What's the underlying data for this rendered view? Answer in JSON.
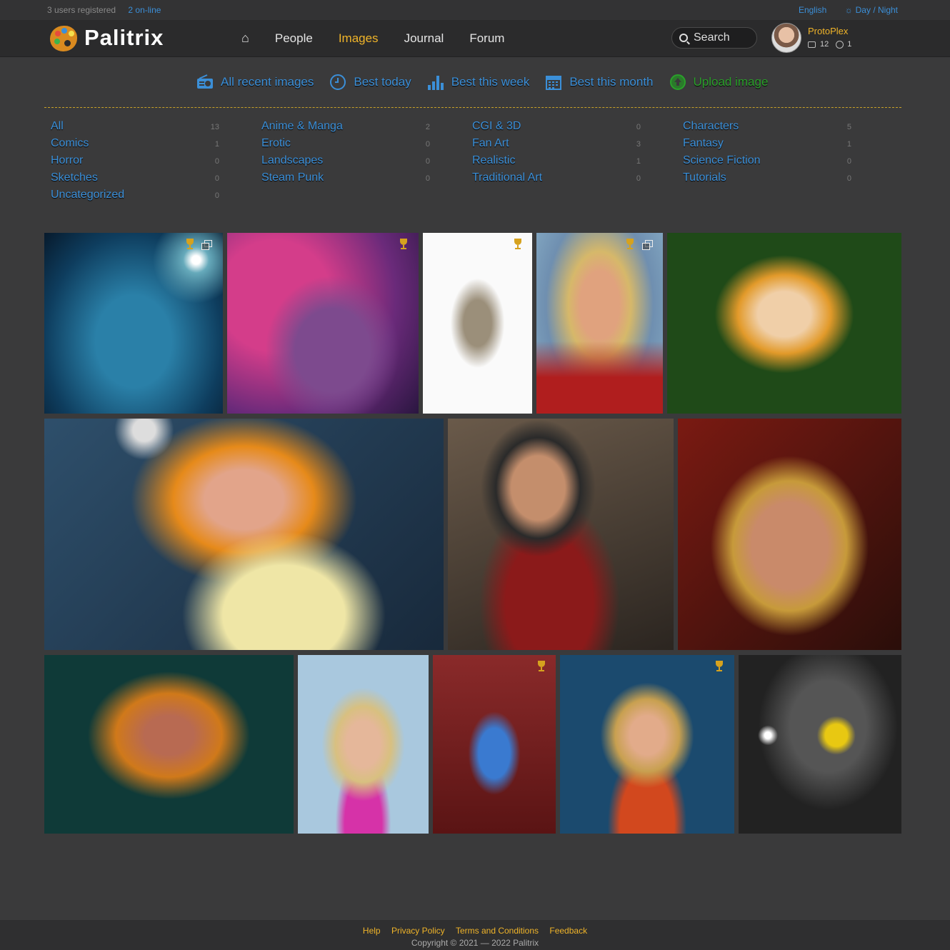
{
  "topbar": {
    "users_registered": "3 users registered",
    "online": "2 on-line",
    "language": "English",
    "day_night": "Day / Night"
  },
  "header": {
    "logo_text": "Palitrix",
    "nav": [
      "People",
      "Images",
      "Journal",
      "Forum"
    ],
    "active_nav": "Images",
    "search_placeholder": "Search",
    "user": {
      "name": "ProtoPlex",
      "images": "12",
      "other": "1"
    }
  },
  "subnav": {
    "all_recent": "All recent images",
    "best_today": "Best today",
    "best_week": "Best this week",
    "best_month": "Best this month",
    "upload": "Upload image"
  },
  "categories": [
    {
      "name": "All",
      "count": "13"
    },
    {
      "name": "Anime & Manga",
      "count": "2"
    },
    {
      "name": "CGI & 3D",
      "count": "0"
    },
    {
      "name": "Characters",
      "count": "5"
    },
    {
      "name": "Comics",
      "count": "1"
    },
    {
      "name": "Erotic",
      "count": "0"
    },
    {
      "name": "Fan Art",
      "count": "3"
    },
    {
      "name": "Fantasy",
      "count": "1"
    },
    {
      "name": "Horror",
      "count": "0"
    },
    {
      "name": "Landscapes",
      "count": "0"
    },
    {
      "name": "Realistic",
      "count": "1"
    },
    {
      "name": "Science Fiction",
      "count": "0"
    },
    {
      "name": "Sketches",
      "count": "0"
    },
    {
      "name": "Steam Punk",
      "count": "0"
    },
    {
      "name": "Traditional Art",
      "count": "0"
    },
    {
      "name": "Tutorials",
      "count": "0"
    },
    {
      "name": "Uncategorized",
      "count": "0"
    }
  ],
  "colors": {
    "accent": "#f0b429",
    "link": "#3b8fd8",
    "upload": "#2aa02a",
    "background": "#3a3a3b"
  },
  "footer": {
    "links": [
      "Help",
      "Privacy Policy",
      "Terms and Conditions",
      "Feedback"
    ],
    "copyright": "Copyright © 2021 — 2022 Palitrix"
  }
}
